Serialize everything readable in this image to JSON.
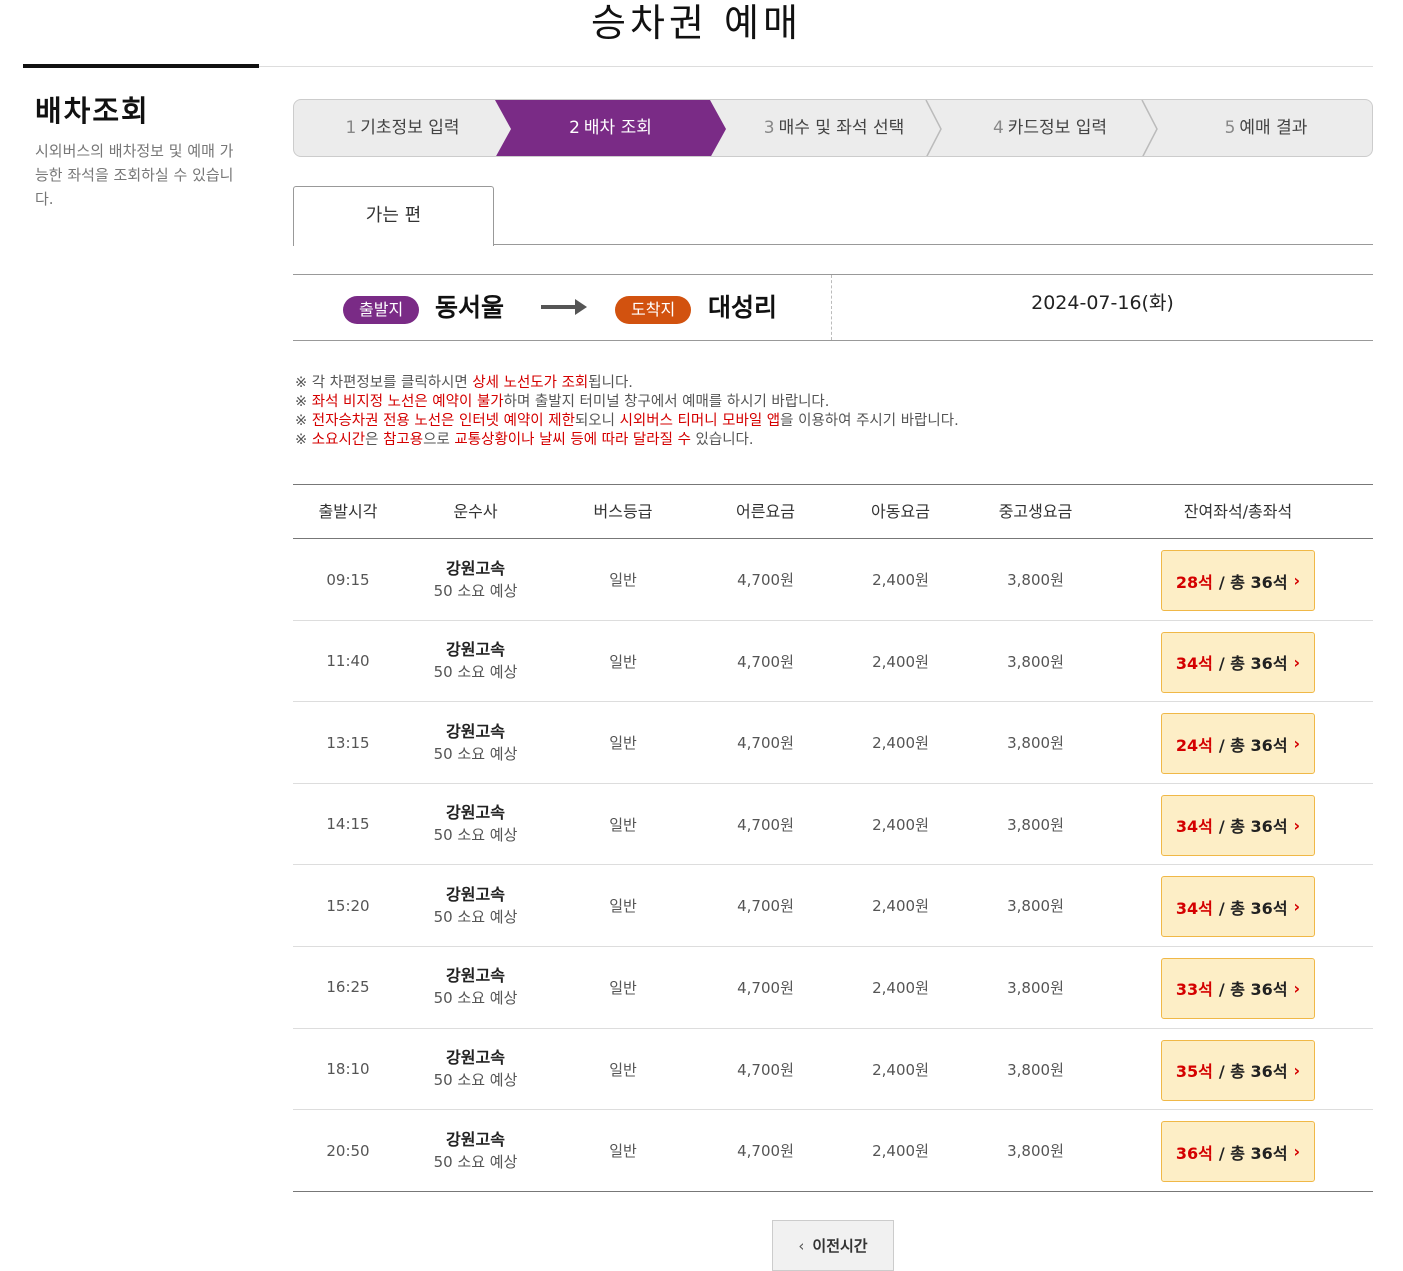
{
  "page": {
    "title": "승차권 예매"
  },
  "side": {
    "title": "배차조회",
    "desc": "시외버스의 배차정보 및 예매 가능한 좌석을 조회하실 수 있습니다."
  },
  "steps": [
    {
      "num": "1",
      "label": "기초정보 입력",
      "active": false
    },
    {
      "num": "2",
      "label": "배차 조회",
      "active": true
    },
    {
      "num": "3",
      "label": "매수 및 좌석 선택",
      "active": false
    },
    {
      "num": "4",
      "label": "카드정보 입력",
      "active": false
    },
    {
      "num": "5",
      "label": "예매 결과",
      "active": false
    }
  ],
  "colors": {
    "accent_purple": "#7a2b86",
    "accent_orange": "#d2520f",
    "highlight_red": "#d40000",
    "seat_button_bg": "#fdeec6"
  },
  "tab": {
    "label": "가는 편"
  },
  "route": {
    "dep_badge": "출발지",
    "dep_place": "동서울",
    "arr_badge": "도착지",
    "arr_place": "대성리",
    "date": "2024-07-16(화)"
  },
  "notices": [
    [
      {
        "t": "※ 각 차편정보를 클릭하시면 "
      },
      {
        "t": "상세 노선도가 조회",
        "hl": true
      },
      {
        "t": "됩니다."
      }
    ],
    [
      {
        "t": "※ "
      },
      {
        "t": "좌석 비지정 노선은 예약이 불가",
        "hl": true
      },
      {
        "t": "하며 출발지 터미널 창구에서 예매를 하시기 바랍니다."
      }
    ],
    [
      {
        "t": "※ "
      },
      {
        "t": "전자승차권 전용 노선은 인터넷 예약이 제한",
        "hl": true
      },
      {
        "t": "되오니 "
      },
      {
        "t": "시외버스 티머니 모바일 앱",
        "hl": true
      },
      {
        "t": "을 이용하여 주시기 바랍니다."
      }
    ],
    [
      {
        "t": "※ "
      },
      {
        "t": "소요시간",
        "hl": true
      },
      {
        "t": "은 "
      },
      {
        "t": "참고용",
        "hl": true
      },
      {
        "t": "으로 "
      },
      {
        "t": "교통상황이나 날씨 등에 따라 달라질 수",
        "hl": true
      },
      {
        "t": " 있습니다."
      }
    ]
  ],
  "table": {
    "headers": [
      "출발시각",
      "운수사",
      "버스등급",
      "어른요금",
      "아동요금",
      "중고생요금",
      "잔여좌석/총좌석"
    ],
    "rows": [
      {
        "time": "09:15",
        "carrier": "강원고속",
        "duration": "50 소요 예상",
        "grade": "일반",
        "adult": "4,700원",
        "child": "2,400원",
        "teen": "3,800원",
        "remain": "28석",
        "total": "/ 총 36석"
      },
      {
        "time": "11:40",
        "carrier": "강원고속",
        "duration": "50 소요 예상",
        "grade": "일반",
        "adult": "4,700원",
        "child": "2,400원",
        "teen": "3,800원",
        "remain": "34석",
        "total": "/ 총 36석"
      },
      {
        "time": "13:15",
        "carrier": "강원고속",
        "duration": "50 소요 예상",
        "grade": "일반",
        "adult": "4,700원",
        "child": "2,400원",
        "teen": "3,800원",
        "remain": "24석",
        "total": "/ 총 36석"
      },
      {
        "time": "14:15",
        "carrier": "강원고속",
        "duration": "50 소요 예상",
        "grade": "일반",
        "adult": "4,700원",
        "child": "2,400원",
        "teen": "3,800원",
        "remain": "34석",
        "total": "/ 총 36석"
      },
      {
        "time": "15:20",
        "carrier": "강원고속",
        "duration": "50 소요 예상",
        "grade": "일반",
        "adult": "4,700원",
        "child": "2,400원",
        "teen": "3,800원",
        "remain": "34석",
        "total": "/ 총 36석"
      },
      {
        "time": "16:25",
        "carrier": "강원고속",
        "duration": "50 소요 예상",
        "grade": "일반",
        "adult": "4,700원",
        "child": "2,400원",
        "teen": "3,800원",
        "remain": "33석",
        "total": "/ 총 36석"
      },
      {
        "time": "18:10",
        "carrier": "강원고속",
        "duration": "50 소요 예상",
        "grade": "일반",
        "adult": "4,700원",
        "child": "2,400원",
        "teen": "3,800원",
        "remain": "35석",
        "total": "/ 총 36석"
      },
      {
        "time": "20:50",
        "carrier": "강원고속",
        "duration": "50 소요 예상",
        "grade": "일반",
        "adult": "4,700원",
        "child": "2,400원",
        "teen": "3,800원",
        "remain": "36석",
        "total": "/ 총 36석"
      }
    ]
  },
  "footer": {
    "prev_label": "이전시간",
    "prev_icon": "chevron-left-icon"
  }
}
